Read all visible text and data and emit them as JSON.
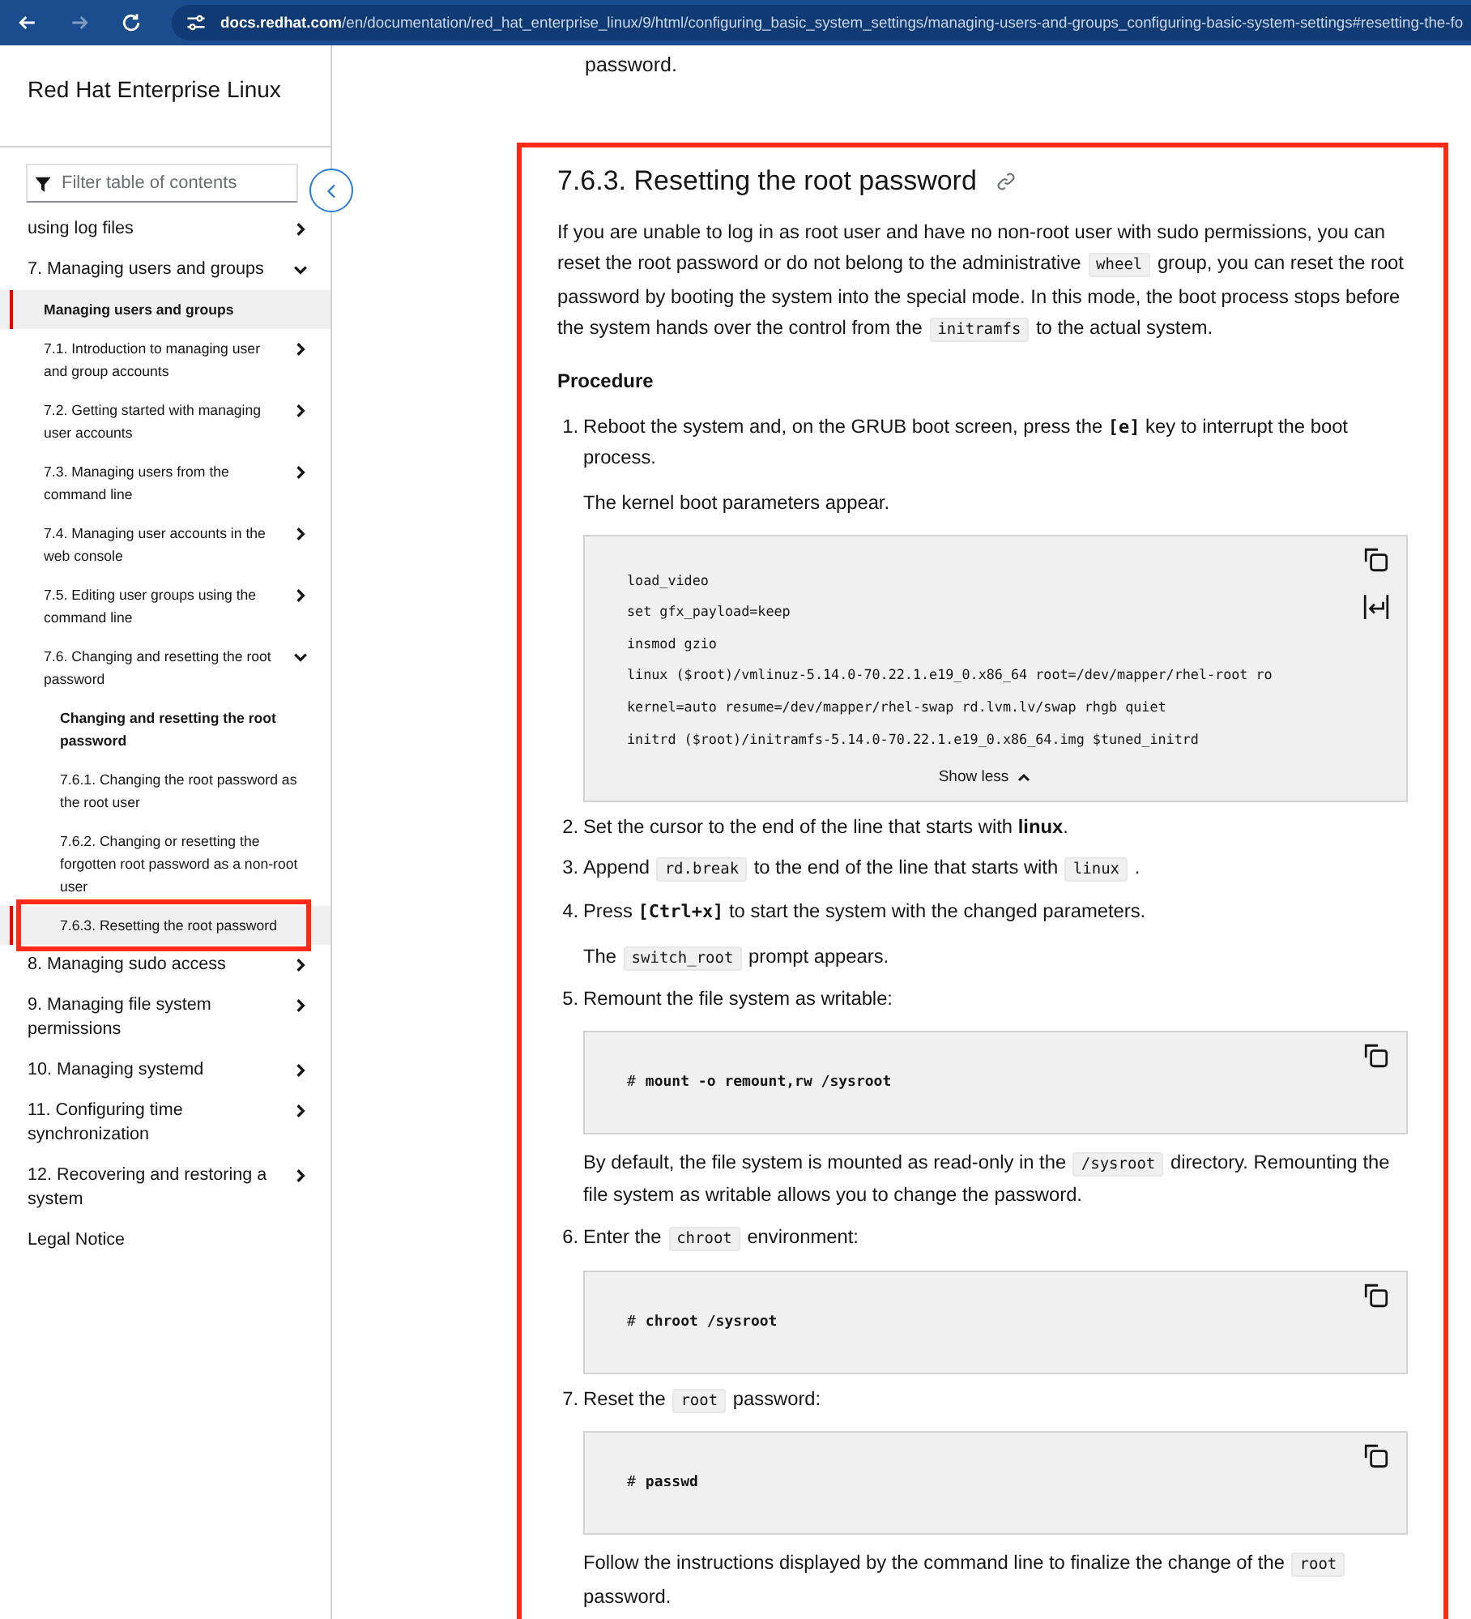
{
  "browser": {
    "nav": [
      {
        "kind": "back",
        "disabled": false
      },
      {
        "kind": "forward",
        "disabled": true
      },
      {
        "kind": "reload",
        "disabled": false
      }
    ],
    "url_host": "docs.redhat.com",
    "url_path": "/en/documentation/red_hat_enterprise_linux/9/html/configuring_basic_system_settings/managing-users-and-groups_configuring-basic-system-settings#resetting-the-fo"
  },
  "sidebar": {
    "title": "Red Hat Enterprise Linux",
    "filter_placeholder": "Filter table of contents",
    "toc": [
      {
        "label": "using log files",
        "expanded": false,
        "selected": false
      },
      {
        "label": "7. Managing users and groups",
        "expanded": true,
        "selected": false,
        "children": [
          {
            "label": "Managing users and groups",
            "kind": "overview",
            "selected": true
          },
          {
            "label": "7.1. Introduction to managing user and group accounts",
            "expanded": false,
            "selected": false
          },
          {
            "label": "7.2. Getting started with managing user accounts",
            "expanded": false,
            "selected": false
          },
          {
            "label": "7.3. Managing users from the command line",
            "expanded": false,
            "selected": false
          },
          {
            "label": "7.4. Managing user accounts in the web console",
            "expanded": false,
            "selected": false
          },
          {
            "label": "7.5. Editing user groups using the command line",
            "expanded": false,
            "selected": false
          },
          {
            "label": "7.6. Changing and resetting the root password",
            "expanded": true,
            "selected": false,
            "children": [
              {
                "label": "Changing and resetting the root password",
                "kind": "overview",
                "selected": false
              },
              {
                "label": "7.6.1. Changing the root password as the root user",
                "selected": false
              },
              {
                "label": "7.6.2. Changing or resetting the forgotten root password as a non-root user",
                "selected": false
              },
              {
                "label": "7.6.3. Resetting the root password",
                "selected": true,
                "highlighted": true
              }
            ]
          }
        ]
      },
      {
        "label": "8. Managing sudo access",
        "expanded": false,
        "selected": false
      },
      {
        "label": "9. Managing file system permissions",
        "expanded": false,
        "selected": false
      },
      {
        "label": "10. Managing systemd",
        "expanded": false,
        "selected": false
      },
      {
        "label": "11. Configuring time synchronization",
        "expanded": false,
        "selected": false
      },
      {
        "label": "12. Recovering and restoring a system",
        "expanded": false,
        "selected": false
      },
      {
        "label": "Legal Notice",
        "selected": false
      }
    ]
  },
  "content": {
    "top_fragment": "password.",
    "section": {
      "highlighted": true,
      "heading": "7.6.3. Resetting the root password",
      "intro": [
        {
          "kind": "text",
          "text": "If you are unable to log in as root user and have no non-root user with sudo permissions, you can reset the root password or do not belong to the administrative "
        },
        {
          "kind": "code",
          "text": "wheel"
        },
        {
          "kind": "text",
          "text": " group, you can reset the root password by booting the system into the special mode. In this mode, the boot process stops before the system hands over the control from the "
        },
        {
          "kind": "code",
          "text": "initramfs"
        },
        {
          "kind": "text",
          "text": " to the actual system."
        }
      ],
      "procedure_title": "Procedure",
      "steps": [
        {
          "number": "1.",
          "text": [
            {
              "kind": "text",
              "text": "Reboot the system and, on the GRUB boot screen, press the "
            },
            {
              "kind": "kbd",
              "text": "[e]"
            },
            {
              "kind": "text",
              "text": " key to interrupt the boot process."
            }
          ],
          "blocks": [
            {
              "kind": "para",
              "segments": [
                {
                  "kind": "text",
                  "text": "The kernel boot parameters appear."
                }
              ]
            },
            {
              "kind": "listing",
              "wrap_button": true,
              "show_less": "Show less",
              "lines": [
                "load_video",
                "set gfx_payload=keep",
                "insmod gzio",
                "linux ($root)/vmlinuz-5.14.0-70.22.1.e19_0.x86_64 root=/dev/mapper/rhel-root ro",
                "kernel=auto resume=/dev/mapper/rhel-swap rd.lvm.lv/swap rhgb quiet",
                "initrd ($root)/initramfs-5.14.0-70.22.1.e19_0.x86_64.img $tuned_initrd"
              ]
            }
          ]
        },
        {
          "number": "2.",
          "text": [
            {
              "kind": "text",
              "text": "Set the cursor to the end of the line that starts with "
            },
            {
              "kind": "bold",
              "text": "linux"
            },
            {
              "kind": "text",
              "text": "."
            }
          ]
        },
        {
          "number": "3.",
          "text": [
            {
              "kind": "text",
              "text": "Append "
            },
            {
              "kind": "code",
              "text": "rd.break"
            },
            {
              "kind": "text",
              "text": " to the end of the line that starts with "
            },
            {
              "kind": "code",
              "text": "linux"
            },
            {
              "kind": "text",
              "text": " ."
            }
          ]
        },
        {
          "number": "4.",
          "text": [
            {
              "kind": "text",
              "text": "Press "
            },
            {
              "kind": "kbd",
              "text": "[Ctrl+x]"
            },
            {
              "kind": "text",
              "text": " to start the system with the changed parameters."
            }
          ],
          "blocks": [
            {
              "kind": "para",
              "segments": [
                {
                  "kind": "text",
                  "text": "The "
                },
                {
                  "kind": "code",
                  "text": "switch_root"
                },
                {
                  "kind": "text",
                  "text": " prompt appears."
                }
              ]
            }
          ]
        },
        {
          "number": "5.",
          "text": [
            {
              "kind": "text",
              "text": "Remount the file system as writable:"
            }
          ],
          "blocks": [
            {
              "kind": "command",
              "prompt": "#",
              "command": "mount -o remount,rw /sysroot"
            },
            {
              "kind": "para",
              "segments": [
                {
                  "kind": "text",
                  "text": "By default, the file system is mounted as read-only in the "
                },
                {
                  "kind": "code",
                  "text": "/sysroot"
                },
                {
                  "kind": "text",
                  "text": " directory. Remounting the file system as writable allows you to change the password."
                }
              ]
            }
          ]
        },
        {
          "number": "6.",
          "text": [
            {
              "kind": "text",
              "text": "Enter the "
            },
            {
              "kind": "code",
              "text": "chroot"
            },
            {
              "kind": "text",
              "text": " environment:"
            }
          ],
          "blocks": [
            {
              "kind": "command",
              "prompt": "#",
              "command": "chroot /sysroot"
            }
          ]
        },
        {
          "number": "7.",
          "text": [
            {
              "kind": "text",
              "text": "Reset the "
            },
            {
              "kind": "code",
              "text": "root"
            },
            {
              "kind": "text",
              "text": " password:"
            }
          ],
          "blocks": [
            {
              "kind": "command",
              "prompt": "#",
              "command": "passwd"
            },
            {
              "kind": "para",
              "segments": [
                {
                  "kind": "text",
                  "text": "Follow the instructions displayed by the command line to finalize the change of the "
                },
                {
                  "kind": "code",
                  "text": "root"
                },
                {
                  "kind": "text",
                  "text": " password."
                }
              ]
            }
          ]
        }
      ]
    }
  }
}
